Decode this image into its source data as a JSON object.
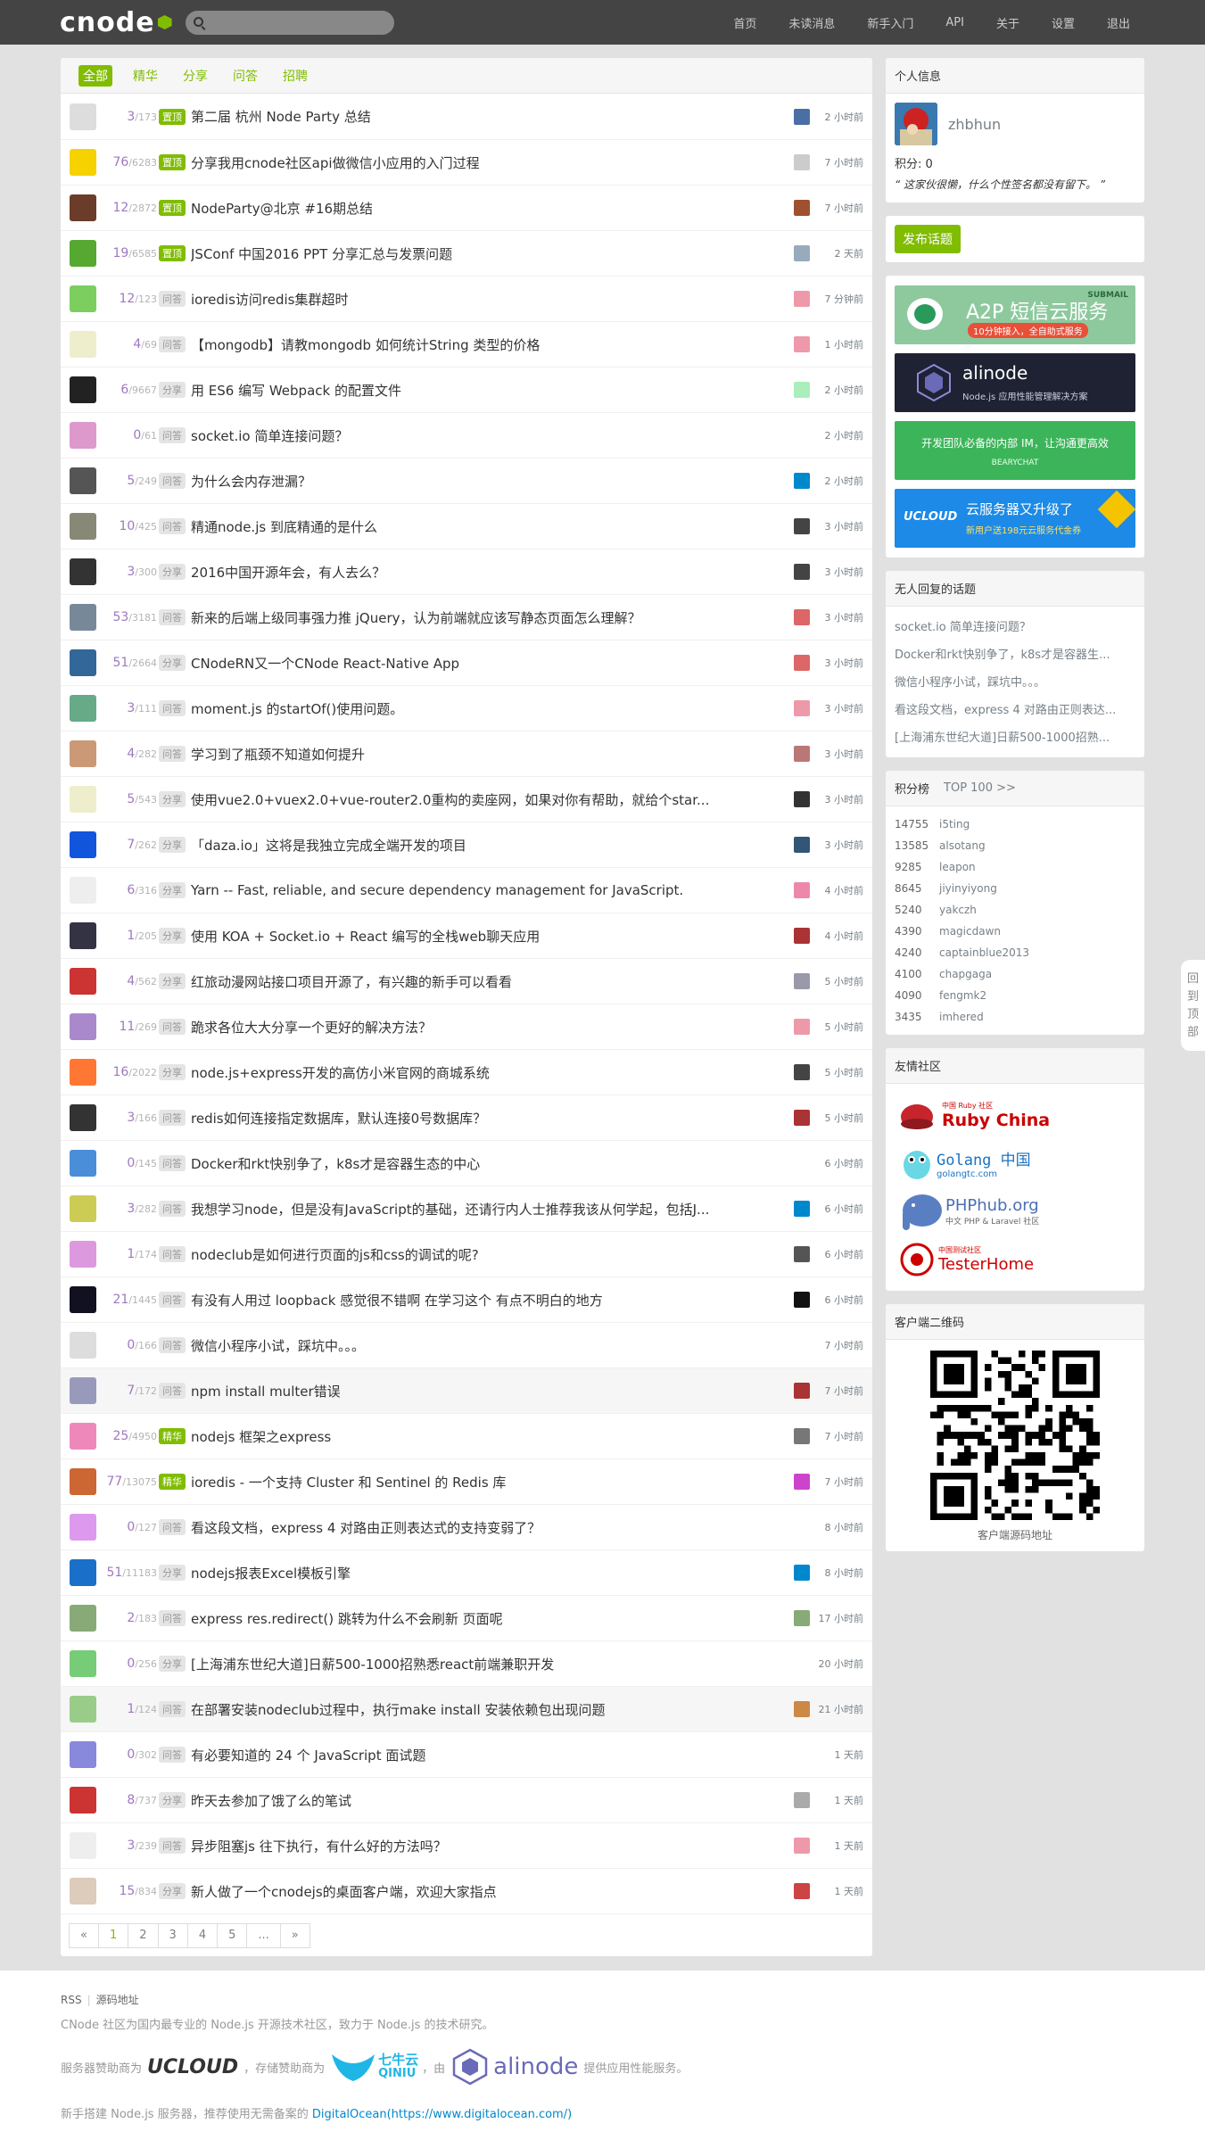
{
  "header": {
    "logo": "cnode",
    "search_placeholder": "",
    "nav": [
      "首页",
      "未读消息",
      "新手入门",
      "API",
      "关于",
      "设置",
      "退出"
    ]
  },
  "tabs": [
    "全部",
    "精华",
    "分享",
    "问答",
    "招聘"
  ],
  "topics": [
    {
      "r": "3",
      "v": "173",
      "tag": "置顶",
      "top": true,
      "title": "第二届 杭州 Node Party 总结",
      "time": "2 小时前",
      "ac": "#ddd",
      "rc": "#4a6fa5"
    },
    {
      "r": "76",
      "v": "6283",
      "tag": "置顶",
      "top": true,
      "title": "分享我用cnode社区api做微信小应用的入门过程",
      "time": "7 小时前",
      "ac": "#f5d200",
      "rc": "#ccc"
    },
    {
      "r": "12",
      "v": "2872",
      "tag": "置顶",
      "top": true,
      "title": "NodeParty@北京 #16期总结",
      "time": "7 小时前",
      "ac": "#6b3c2a",
      "rc": "#a05030"
    },
    {
      "r": "19",
      "v": "6585",
      "tag": "置顶",
      "top": true,
      "title": "JSConf 中国2016 PPT 分享汇总与发票问题",
      "time": "2 天前",
      "ac": "#55a830",
      "rc": "#9ab"
    },
    {
      "r": "12",
      "v": "123",
      "tag": "问答",
      "top": false,
      "title": "ioredis访问redis集群超时",
      "time": "7 分钟前",
      "ac": "#7ccf5f",
      "rc": "#e9a"
    },
    {
      "r": "4",
      "v": "69",
      "tag": "问答",
      "top": false,
      "title": "【mongodb】请教mongodb 如何统计String 类型的价格",
      "time": "1 小时前",
      "ac": "#eec",
      "rc": "#e9a"
    },
    {
      "r": "6",
      "v": "9667",
      "tag": "分享",
      "top": false,
      "title": "用 ES6 编写 Webpack 的配置文件",
      "time": "2 小时前",
      "ac": "#222",
      "rc": "#aeb"
    },
    {
      "r": "0",
      "v": "61",
      "tag": "问答",
      "top": false,
      "title": "socket.io 简单连接问题？",
      "time": "2 小时前",
      "ac": "#d9c",
      "rc": ""
    },
    {
      "r": "5",
      "v": "249",
      "tag": "问答",
      "top": false,
      "title": "为什么会内存泄漏？",
      "time": "2 小时前",
      "ac": "#555",
      "rc": "#08c"
    },
    {
      "r": "10",
      "v": "425",
      "tag": "问答",
      "top": false,
      "title": "精通node.js 到底精通的是什么",
      "time": "3 小时前",
      "ac": "#887",
      "rc": "#444"
    },
    {
      "r": "3",
      "v": "300",
      "tag": "分享",
      "top": false,
      "title": "2016中国开源年会，有人去么？",
      "time": "3 小时前",
      "ac": "#333",
      "rc": "#444"
    },
    {
      "r": "53",
      "v": "3181",
      "tag": "问答",
      "top": false,
      "title": "新来的后端上级同事强力推 jQuery，认为前端就应该写静态页面怎么理解？",
      "time": "3 小时前",
      "ac": "#789",
      "rc": "#d66"
    },
    {
      "r": "51",
      "v": "2664",
      "tag": "分享",
      "top": false,
      "title": "CNodeRN又一个CNode React-Native App",
      "time": "3 小时前",
      "ac": "#369",
      "rc": "#d66"
    },
    {
      "r": "3",
      "v": "111",
      "tag": "问答",
      "top": false,
      "title": "moment.js 的startOf()使用问题。",
      "time": "3 小时前",
      "ac": "#6a8",
      "rc": "#e9a"
    },
    {
      "r": "4",
      "v": "282",
      "tag": "问答",
      "top": false,
      "title": "学习到了瓶颈不知道如何提升",
      "time": "3 小时前",
      "ac": "#c97",
      "rc": "#b77"
    },
    {
      "r": "5",
      "v": "543",
      "tag": "分享",
      "top": false,
      "title": "使用vue2.0+vuex2.0+vue-router2.0重构的卖座网，如果对你有帮助，就给个star...",
      "time": "3 小时前",
      "ac": "#eec",
      "rc": "#333"
    },
    {
      "r": "7",
      "v": "262",
      "tag": "分享",
      "top": false,
      "title": "「daza.io」这将是我独立完成全端开发的项目",
      "time": "3 小时前",
      "ac": "#1155dd",
      "rc": "#357"
    },
    {
      "r": "6",
      "v": "316",
      "tag": "分享",
      "top": false,
      "title": "Yarn -- Fast, reliable, and secure dependency management for JavaScript.",
      "time": "4 小时前",
      "ac": "#eee",
      "rc": "#e8a"
    },
    {
      "r": "1",
      "v": "205",
      "tag": "分享",
      "top": false,
      "title": "使用 KOA + Socket.io + React 编写的全栈web聊天应用",
      "time": "4 小时前",
      "ac": "#334",
      "rc": "#a33"
    },
    {
      "r": "4",
      "v": "562",
      "tag": "分享",
      "top": false,
      "title": "红旅动漫网站接口项目开源了，有兴趣的新手可以看看",
      "time": "5 小时前",
      "ac": "#c33",
      "rc": "#99a"
    },
    {
      "r": "11",
      "v": "269",
      "tag": "问答",
      "top": false,
      "title": "跪求各位大大分享一个更好的解决方法？",
      "time": "5 小时前",
      "ac": "#a8c",
      "rc": "#e9a"
    },
    {
      "r": "16",
      "v": "2022",
      "tag": "分享",
      "top": false,
      "title": "node.js+express开发的高仿小米官网的商城系统",
      "time": "5 小时前",
      "ac": "#f73",
      "rc": "#444"
    },
    {
      "r": "3",
      "v": "166",
      "tag": "问答",
      "top": false,
      "title": "redis如何连接指定数据库，默认连接0号数据库？",
      "time": "5 小时前",
      "ac": "#333",
      "rc": "#a33"
    },
    {
      "r": "0",
      "v": "145",
      "tag": "问答",
      "top": false,
      "title": "Docker和rkt快别争了，k8s才是容器生态的中心",
      "time": "6 小时前",
      "ac": "#4a8ed9",
      "rc": ""
    },
    {
      "r": "3",
      "v": "282",
      "tag": "问答",
      "top": false,
      "title": "我想学习node，但是没有JavaScript的基础，还请行内人士推荐我该从何学起，包括J...",
      "time": "6 小时前",
      "ac": "#cc5",
      "rc": "#08c"
    },
    {
      "r": "1",
      "v": "174",
      "tag": "问答",
      "top": false,
      "title": "nodeclub是如何进行页面的js和css的调试的呢?",
      "time": "6 小时前",
      "ac": "#d9d",
      "rc": "#555"
    },
    {
      "r": "21",
      "v": "1445",
      "tag": "问答",
      "top": false,
      "title": "有没有人用过 loopback 感觉很不错啊 在学习这个 有点不明白的地方",
      "time": "6 小时前",
      "ac": "#112",
      "rc": "#111"
    },
    {
      "r": "0",
      "v": "166",
      "tag": "问答",
      "top": false,
      "title": "微信小程序小试，踩坑中。。。",
      "time": "7 小时前",
      "ac": "#ddd",
      "rc": ""
    },
    {
      "r": "7",
      "v": "172",
      "tag": "问答",
      "top": false,
      "title": "npm install multer错误",
      "time": "7 小时前",
      "ac": "#99b",
      "rc": "#a33",
      "hl": true
    },
    {
      "r": "25",
      "v": "4950",
      "tag": "精华",
      "top": true,
      "title": "nodejs 框架之express",
      "time": "7 小时前",
      "ac": "#e8b",
      "rc": "#777"
    },
    {
      "r": "77",
      "v": "13075",
      "tag": "精华",
      "top": true,
      "title": "ioredis - 一个支持 Cluster 和 Sentinel 的 Redis 库",
      "time": "7 小时前",
      "ac": "#c63",
      "rc": "#c4c"
    },
    {
      "r": "0",
      "v": "127",
      "tag": "问答",
      "top": false,
      "title": "看这段文档，express 4 对路由正则表达式的支持变弱了？",
      "time": "8 小时前",
      "ac": "#d9e",
      "rc": ""
    },
    {
      "r": "51",
      "v": "11183",
      "tag": "分享",
      "top": false,
      "title": "nodejs报表Excel模板引擎",
      "time": "8 小时前",
      "ac": "#1a6fc9",
      "rc": "#08c"
    },
    {
      "r": "2",
      "v": "183",
      "tag": "问答",
      "top": false,
      "title": "express res.redirect() 跳转为什么不会刷新 页面呢",
      "time": "17 小时前",
      "ac": "#8a7",
      "rc": "#8a7"
    },
    {
      "r": "0",
      "v": "256",
      "tag": "分享",
      "top": false,
      "title": "[上海浦东世纪大道]日薪500-1000招熟悉react前端兼职开发",
      "time": "20 小时前",
      "ac": "#7c7",
      "rc": ""
    },
    {
      "r": "1",
      "v": "124",
      "tag": "问答",
      "top": false,
      "title": "在部署安装nodeclub过程中，执行make install 安装依赖包出现问题",
      "time": "21 小时前",
      "ac": "#9c8",
      "rc": "#c84",
      "hl": true
    },
    {
      "r": "0",
      "v": "302",
      "tag": "问答",
      "top": false,
      "title": "有必要知道的 24 个 JavaScript 面试题",
      "time": "1 天前",
      "ac": "#88d",
      "rc": ""
    },
    {
      "r": "8",
      "v": "737",
      "tag": "分享",
      "top": false,
      "title": "昨天去参加了饿了么的笔试",
      "time": "1 天前",
      "ac": "#c33",
      "rc": "#aaa"
    },
    {
      "r": "3",
      "v": "239",
      "tag": "问答",
      "top": false,
      "title": "异步阻塞js 往下执行，有什么好的方法吗？",
      "time": "1 天前",
      "ac": "#eee",
      "rc": "#e9a"
    },
    {
      "r": "15",
      "v": "834",
      "tag": "分享",
      "top": false,
      "title": "新人做了一个cnodejs的桌面客户端，欢迎大家指点",
      "time": "1 天前",
      "ac": "#dcb",
      "rc": "#c44"
    }
  ],
  "pagination": [
    "«",
    "1",
    "2",
    "3",
    "4",
    "5",
    "...",
    "»"
  ],
  "sidebar": {
    "user_title": "个人信息",
    "username": "zhbhun",
    "score": "积分: 0",
    "signature": "“ 这家伙很懒，什么个性签名都没有留下。 ”",
    "create_topic": "发布话题",
    "ads": {
      "a2p_title": "A2P 短信云服务",
      "a2p_sub": "10分钟接入，全自助式服务",
      "a2p_brand": "SUBMAIL",
      "alinode_title": "alinode",
      "alinode_sub": "Node.js 应用性能管理解决方案",
      "bearychat_title": "开发团队必备的内部 IM，让沟通更高效",
      "bearychat_brand": "BEARYCHAT",
      "ucloud_brand": "UCLOUD",
      "ucloud_title": "云服务器又升级了",
      "ucloud_sub": "新用户送198元云服务代金券"
    },
    "no_reply_title": "无人回复的话题",
    "no_reply": [
      "socket.io 简单连接问题？",
      "Docker和rkt快别争了，k8s才是容器生...",
      "微信小程序小试，踩坑中。。。",
      "看这段文档，express 4 对路由正则表达...",
      "[上海浦东世纪大道]日薪500-1000招熟..."
    ],
    "score_title": "积分榜",
    "score_top": "TOP 100 >>",
    "scores": [
      {
        "s": "14755",
        "n": "i5ting"
      },
      {
        "s": "13585",
        "n": "alsotang"
      },
      {
        "s": "9285",
        "n": "leapon"
      },
      {
        "s": "8645",
        "n": "jiyinyiyong"
      },
      {
        "s": "5240",
        "n": "yakczh"
      },
      {
        "s": "4390",
        "n": "magicdawn"
      },
      {
        "s": "4240",
        "n": "captainblue2013"
      },
      {
        "s": "4100",
        "n": "chapgaga"
      },
      {
        "s": "4090",
        "n": "fengmk2"
      },
      {
        "s": "3435",
        "n": "imhered"
      }
    ],
    "friends_title": "友情社区",
    "friends": {
      "ruby": "Ruby China",
      "ruby_small": "中国 Ruby 社区",
      "golang": "Golang 中国",
      "golang_sub": "golangtc.com",
      "phphub": "PHPhub.org",
      "phphub_sub": "中文 PHP & Laravel 社区",
      "testerhome": "TesterHome",
      "testerhome_small": "中国测试社区"
    },
    "qr_title": "客户端二维码",
    "qr_label": "客户端源码地址"
  },
  "back_top": [
    "回",
    "到",
    "顶",
    "部"
  ],
  "footer": {
    "rss": "RSS",
    "source": "源码地址",
    "desc": "CNode 社区为国内最专业的 Node.js 开源技术社区，致力于 Node.js 的技术研究。",
    "sponsor_a": "服务器赞助商为",
    "sponsor_b": "，存储赞助商为",
    "sponsor_c": "，由",
    "sponsor_d": "提供应用性能服务。",
    "ucloud": "UCLOUD",
    "qiniu": "七牛云",
    "qiniu_en": "QINIU",
    "alinode": "alinode",
    "guide": "新手搭建 Node.js 服务器，推荐使用无需备案的",
    "do_link": "DigitalOcean(https://www.digitalocean.com/)"
  }
}
